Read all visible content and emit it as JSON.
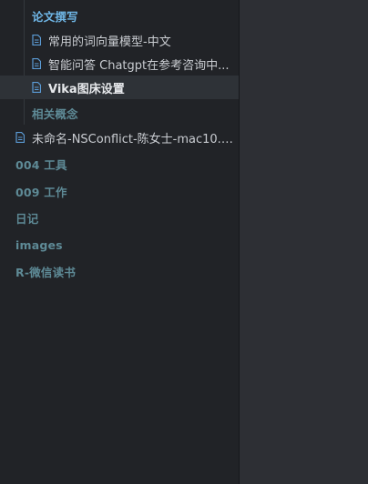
{
  "colors": {
    "folder_open": "#6fb6e6",
    "folder": "#5e8a96",
    "file_icon": "#5b9bd5"
  },
  "tree": {
    "folder_thesis": "论文撰写",
    "thesis_files": [
      {
        "label": "常用的词向量模型-中文",
        "icon": "file-text-icon"
      },
      {
        "label": "智能问答 Chatgpt在参考咨询中...",
        "icon": "file-text-icon"
      },
      {
        "label": "Vika图床设置",
        "icon": "file-text-icon"
      }
    ],
    "folder_related": "相关概念",
    "conflict_file": {
      "label": "未命名-NSConflict-陈女士-mac10.1...",
      "icon": "file-text-icon"
    },
    "folders": [
      {
        "label": "004 工具"
      },
      {
        "label": "009 工作"
      },
      {
        "label": "日记"
      },
      {
        "label": "images"
      },
      {
        "label": "R-微信读书"
      }
    ]
  }
}
